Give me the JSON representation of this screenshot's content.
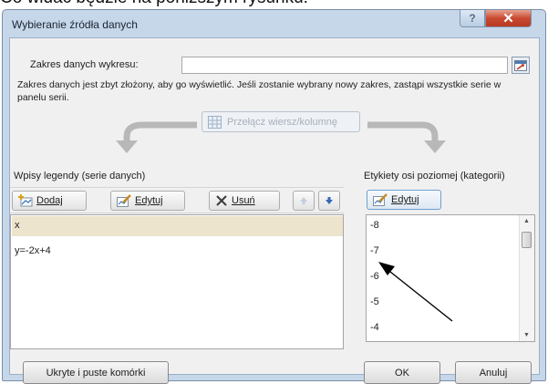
{
  "caption": "Co widać będzie na poniższym rysunku:",
  "window": {
    "title": "Wybieranie źródła danych",
    "help_label": "?",
    "close_label": "✕"
  },
  "range": {
    "label": "Zakres danych wykresu:",
    "value": ""
  },
  "note": "Zakres danych jest zbyt złożony, aby go wyświetlić. Jeśli zostanie wybrany nowy zakres, zastąpi wszystkie serie w panelu serii.",
  "switch_label": "Przełącz wiersz/kolumnę",
  "legend": {
    "label": "Wpisy legendy (serie danych)",
    "buttons": {
      "add": "Dodaj",
      "edit": "Edytuj",
      "remove": "Usuń"
    },
    "items": [
      "x",
      "y=-2x+4"
    ]
  },
  "axis": {
    "label": "Etykiety osi poziomej (kategorii)",
    "edit": "Edytuj",
    "items": [
      "-8",
      "-7",
      "-6",
      "-5",
      "-4"
    ]
  },
  "footer": {
    "hidden_cells": "Ukryte i puste komórki",
    "ok": "OK",
    "cancel": "Anuluj"
  },
  "colors": {
    "frame": "#c6d7ea",
    "client": "#f0f0f0",
    "selection": "#ede4cd",
    "close": "#c94a30"
  }
}
